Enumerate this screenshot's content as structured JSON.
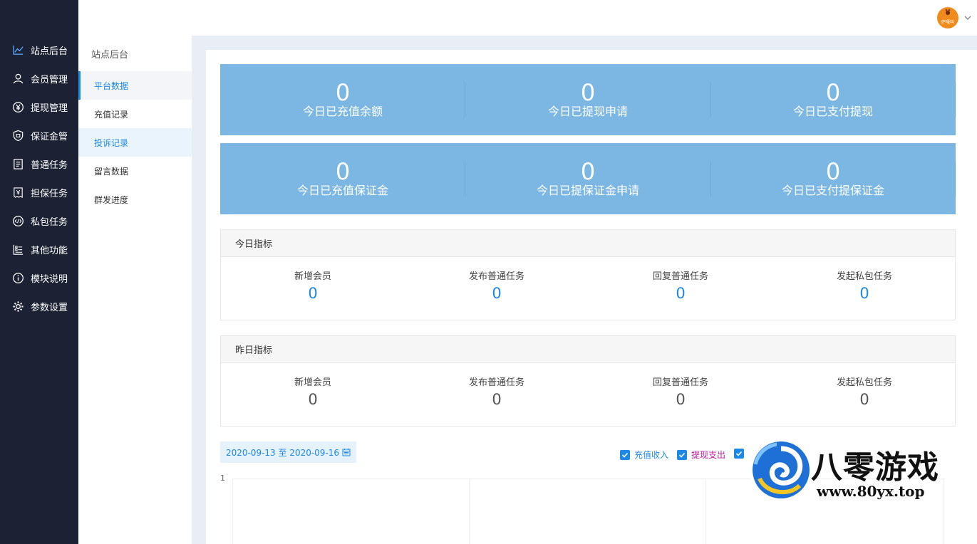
{
  "sidebar": {
    "items": [
      {
        "label": "站点后台",
        "icon": "line-chart-icon",
        "active": true
      },
      {
        "label": "会员管理",
        "icon": "user-icon"
      },
      {
        "label": "提现管理",
        "icon": "yen-circle-icon"
      },
      {
        "label": "保证金管",
        "icon": "shield-icon"
      },
      {
        "label": "普通任务",
        "icon": "document-icon"
      },
      {
        "label": "担保任务",
        "icon": "receipt-icon"
      },
      {
        "label": "私包任务",
        "icon": "code-circle-icon"
      },
      {
        "label": "其他功能",
        "icon": "list-icon"
      },
      {
        "label": "模块说明",
        "icon": "info-icon"
      },
      {
        "label": "参数设置",
        "icon": "gear-icon"
      }
    ]
  },
  "submenu": {
    "title": "站点后台",
    "items": [
      {
        "label": "平台数据",
        "state": "active"
      },
      {
        "label": "充值记录"
      },
      {
        "label": "投诉记录",
        "state": "hover"
      },
      {
        "label": "留言数据"
      },
      {
        "label": "群发进度"
      }
    ]
  },
  "stats": {
    "row1": [
      {
        "value": "0",
        "label": "今日已充值余额"
      },
      {
        "value": "0",
        "label": "今日已提现申请"
      },
      {
        "value": "0",
        "label": "今日已支付提现"
      }
    ],
    "row2": [
      {
        "value": "0",
        "label": "今日已充值保证金"
      },
      {
        "value": "0",
        "label": "今日已提保证金申请"
      },
      {
        "value": "0",
        "label": "今日已支付提保证金"
      }
    ]
  },
  "today": {
    "title": "今日指标",
    "metrics": [
      {
        "label": "新增会员",
        "value": "0"
      },
      {
        "label": "发布普通任务",
        "value": "0"
      },
      {
        "label": "回复普通任务",
        "value": "0"
      },
      {
        "label": "发起私包任务",
        "value": "0"
      }
    ]
  },
  "yesterday": {
    "title": "昨日指标",
    "metrics": [
      {
        "label": "新增会员",
        "value": "0"
      },
      {
        "label": "发布普通任务",
        "value": "0"
      },
      {
        "label": "回复普通任务",
        "value": "0"
      },
      {
        "label": "发起私包任务",
        "value": "0"
      }
    ]
  },
  "chart": {
    "date_range": "2020-09-13 至 2020-09-16",
    "legend": [
      {
        "label": "充值收入",
        "color": "#1e88e5",
        "checked": true
      },
      {
        "label": "提现支出",
        "color": "#c0189a",
        "checked": true
      },
      {
        "label": "",
        "color": "#1e88e5",
        "checked": true
      }
    ],
    "y_axis_top": "1"
  },
  "avatar": {
    "text": "萨嘎叫"
  },
  "watermark": {
    "title": "八零游戏",
    "url": "www.80yx.top"
  },
  "colors": {
    "accent": "#1e88e5",
    "stat_bg": "#7cb7e3",
    "sidebar_bg": "#1c2233"
  }
}
